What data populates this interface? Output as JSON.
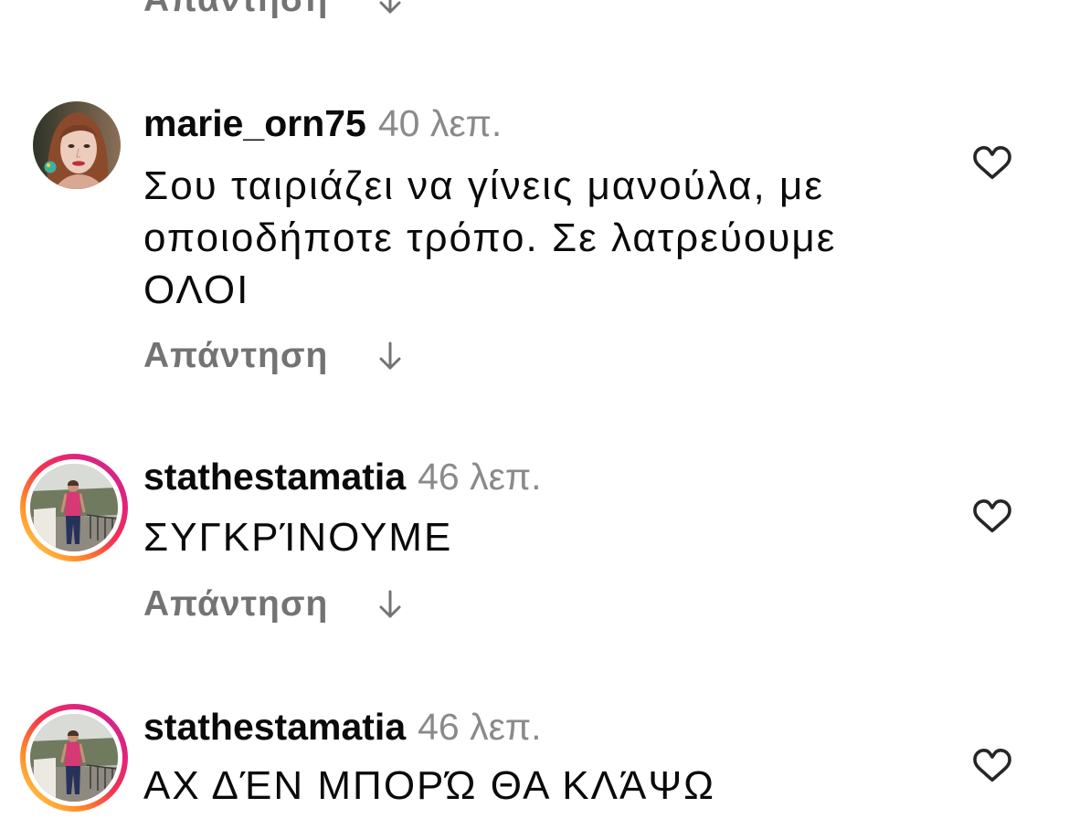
{
  "top_partial_reply": {
    "reply_label": "Απάντηση"
  },
  "comments": [
    {
      "username": "marie_orn75",
      "time": "40 λεπ.",
      "text": "Σου ταιριάζει να γίνεις μανούλα, με οποιοδήποτε τρόπο. Σε λατρεύουμε ΟΛΟΙ",
      "reply_label": "Απάντηση",
      "has_story_ring": false,
      "liked": false
    },
    {
      "username": "stathestamatia",
      "time": "46 λεπ.",
      "text": "ΣΥΓΚΡΊΝΟΥΜΕ",
      "reply_label": "Απάντηση",
      "has_story_ring": true,
      "liked": false
    },
    {
      "username": "stathestamatia",
      "time": "46 λεπ.",
      "text": "ΑΧ ΔΈΝ ΜΠΟΡΏ ΘΑ ΚΛΆΨΩ",
      "has_story_ring": true,
      "liked": false
    }
  ],
  "icons": {
    "like": "heart-outline-icon",
    "reply_toggle": "arrow-down-icon"
  },
  "colors": {
    "text": "#0a0a0a",
    "time": "#8a8a8a",
    "reply": "#737373",
    "icon": "#262626",
    "story_ring": [
      "#ffd54a",
      "#ff8a2a",
      "#f2334f",
      "#e0237d",
      "#c42a9b"
    ]
  }
}
